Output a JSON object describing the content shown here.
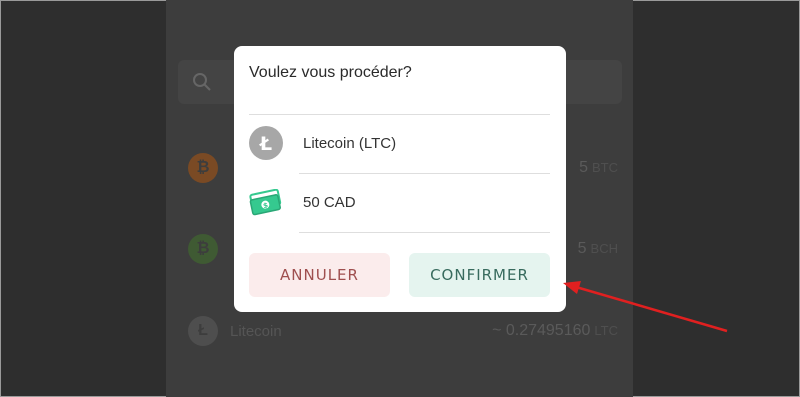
{
  "background": {
    "search_placeholder": "",
    "rows": [
      {
        "coin_icon": "bitcoin-icon",
        "name": "",
        "amount": "5",
        "unit": "BTC",
        "color": "#7a4a24"
      },
      {
        "coin_icon": "bitcoin-cash-icon",
        "name": "",
        "amount": "5",
        "unit": "BCH",
        "color": "#3f5a33"
      },
      {
        "coin_icon": "litecoin-icon",
        "name": "Litecoin",
        "amount": "~ 0.27495160",
        "unit": "LTC",
        "color": "#5a5a5a"
      }
    ]
  },
  "modal": {
    "title": "Voulez vous procéder?",
    "items": [
      {
        "icon": "litecoin-icon",
        "label": "Litecoin (LTC)"
      },
      {
        "icon": "cash-icon",
        "label": "50 CAD"
      }
    ],
    "cancel_label": "ANNULER",
    "confirm_label": "CONFIRMER"
  },
  "annotation": {
    "color": "#e02020"
  }
}
